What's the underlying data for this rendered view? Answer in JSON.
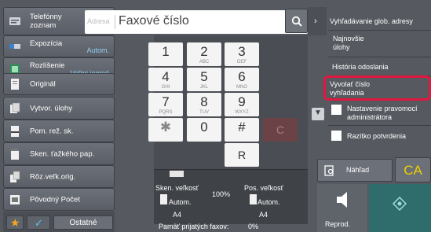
{
  "header": {
    "address_book_label": "Telefónny zoznam",
    "address_label": "Adresa",
    "fax_input_value": "Faxové číslo"
  },
  "left_buttons": [
    {
      "label": "Expozícia",
      "value": "Autom."
    },
    {
      "label": "Rozlíšenie",
      "value": "Veľmi jemné"
    },
    {
      "label": "Originál",
      "value": ""
    },
    {
      "label": "Vytvor. úlohy",
      "value": ""
    },
    {
      "label": "Pom. rež. sk.",
      "value": ""
    },
    {
      "label": "Sken. ťažkého pap.",
      "value": ""
    },
    {
      "label": "Rôz.veľk.orig.",
      "value": ""
    },
    {
      "label": "Pôvodný Počet",
      "value": ""
    }
  ],
  "bottom_bar": {
    "other_label": "Ostatné"
  },
  "keypad": [
    {
      "digit": "1",
      "sub": ""
    },
    {
      "digit": "2",
      "sub": "ABC"
    },
    {
      "digit": "3",
      "sub": "DEF"
    },
    {
      "digit": "4",
      "sub": "GHI"
    },
    {
      "digit": "5",
      "sub": "JKL"
    },
    {
      "digit": "6",
      "sub": "MNO"
    },
    {
      "digit": "7",
      "sub": "PQRS"
    },
    {
      "digit": "8",
      "sub": "TUV"
    },
    {
      "digit": "9",
      "sub": "WXYZ"
    },
    {
      "digit": "✱",
      "sub": ""
    },
    {
      "digit": "0",
      "sub": ""
    },
    {
      "digit": "#",
      "sub": ""
    }
  ],
  "keypad_extra": {
    "clear": "C",
    "redial": "R"
  },
  "scan_info": {
    "scan_size_label": "Sken. veľkosť",
    "send_size_label": "Pos. veľkosť",
    "ratio": "100%",
    "scan_mode": "Autom.",
    "scan_paper": "A4",
    "send_mode": "Autom.",
    "send_paper": "A4",
    "memory_label": "Pamäť prijatých faxov:",
    "memory_value": "0%"
  },
  "right_panel": {
    "global_search": "Vyhľadávanie glob. adresy",
    "recent_jobs": "Najnovšie úlohy",
    "send_history": "História odoslania",
    "call_search_number": "Vyvolať číslo vyhľadania",
    "admin_settings": "Nastavenie pravomocí administrátora",
    "stamp": "Razítko potvrdenia",
    "preview": "Náhľad",
    "ca": "CA",
    "speaker": "Reprod."
  },
  "colors": {
    "highlight": "#e0173f",
    "ca_text": "#e9d200",
    "value_text": "#8fd0f2"
  }
}
